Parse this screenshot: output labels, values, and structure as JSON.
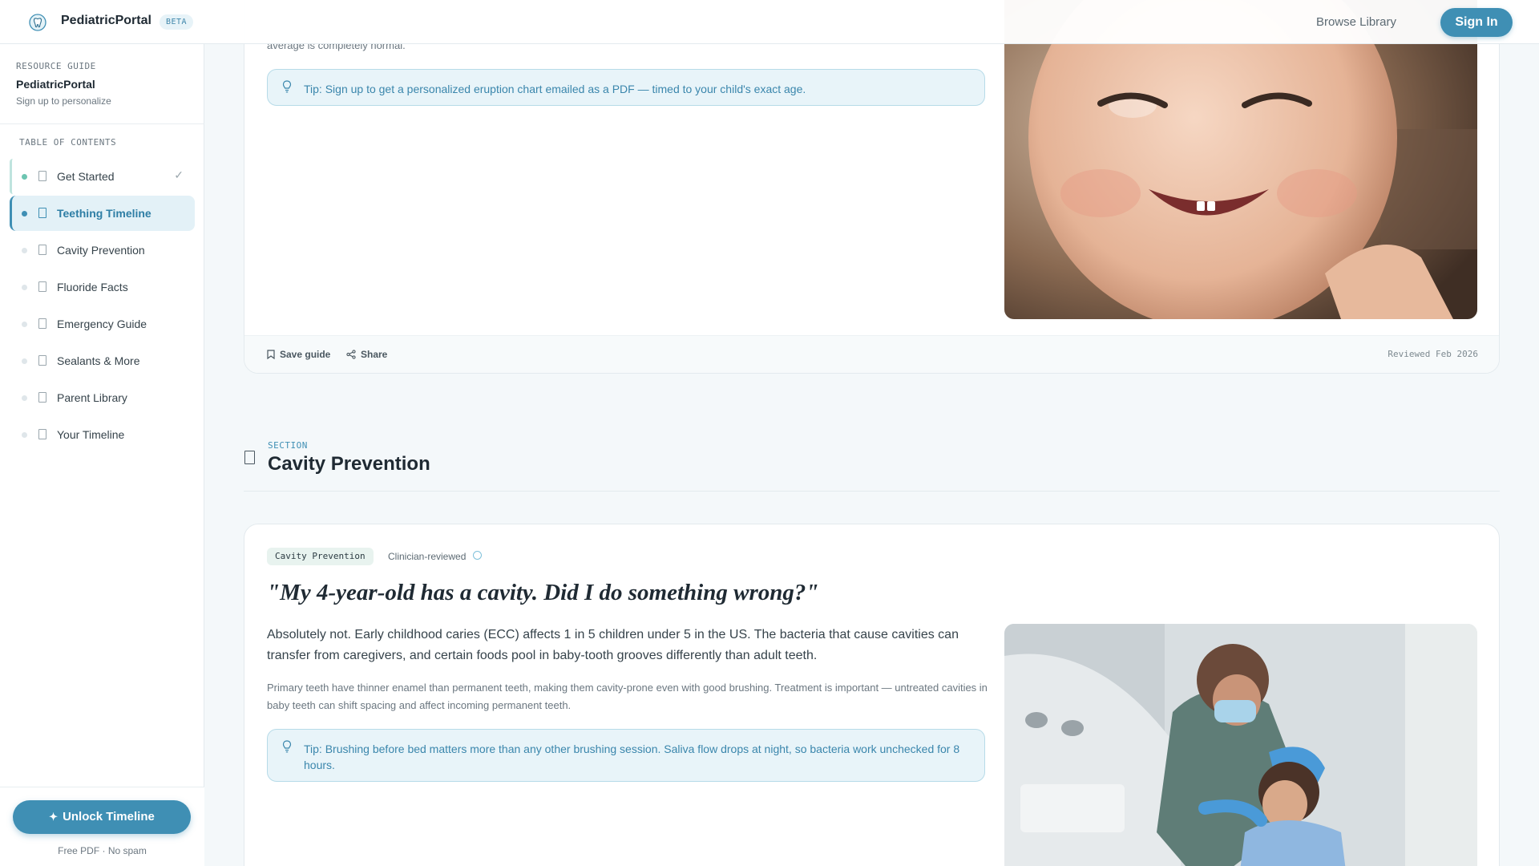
{
  "header": {
    "brand": "PediatricPortal",
    "badge": "BETA",
    "browse": "Browse Library",
    "signin": "Sign In"
  },
  "sidebar": {
    "eyebrow": "RESOURCE GUIDE",
    "title": "PediatricPortal",
    "subtitle": "Sign up to personalize",
    "toc_heading": "TABLE OF CONTENTS",
    "items": [
      {
        "label": "Get Started",
        "state": "done"
      },
      {
        "label": "Teething Timeline",
        "state": "active"
      },
      {
        "label": "Cavity Prevention",
        "state": "default"
      },
      {
        "label": "Fluoride Facts",
        "state": "default"
      },
      {
        "label": "Emergency Guide",
        "state": "default"
      },
      {
        "label": "Sealants & More",
        "state": "default"
      },
      {
        "label": "Parent Library",
        "state": "default"
      },
      {
        "label": "Your Timeline",
        "state": "default"
      }
    ],
    "cta": "Unlock Timeline",
    "cta_note": "Free PDF · No spam"
  },
  "teething_card": {
    "text_tail": "average is completely normal.",
    "tip": "Tip: Sign up to get a personalized eruption chart emailed as a PDF — timed to your child's exact age.",
    "save": "Save guide",
    "share": "Share",
    "reviewed": "Reviewed Feb 2026",
    "image_icon": "smiling-baby-photo"
  },
  "section": {
    "eyebrow": "SECTION",
    "title": "Cavity Prevention"
  },
  "cavity_card": {
    "tag": "Cavity Prevention",
    "reviewed_by": "Clinician-reviewed",
    "quote": "\"My 4-year-old has a cavity. Did I do something wrong?\"",
    "lead": "Absolutely not. Early childhood caries (ECC) affects 1 in 5 children under 5 in the US. The bacteria that cause cavities can transfer from caregivers, and certain foods pool in baby-tooth grooves differently than adult teeth.",
    "body": "Primary teeth have thinner enamel than permanent teeth, making them cavity-prone even with good brushing. Treatment is important — untreated cavities in baby teeth can shift spacing and affect incoming permanent teeth.",
    "tip": "Tip: Brushing before bed matters more than any other brushing session. Saliva flow drops at night, so bacteria work unchecked for 8 hours.",
    "image_icon": "dentist-examining-child-photo"
  },
  "colors": {
    "accent": "#3f8fb4",
    "tip_bg": "#e8f4f9",
    "done_dot": "#6dc5b1"
  }
}
